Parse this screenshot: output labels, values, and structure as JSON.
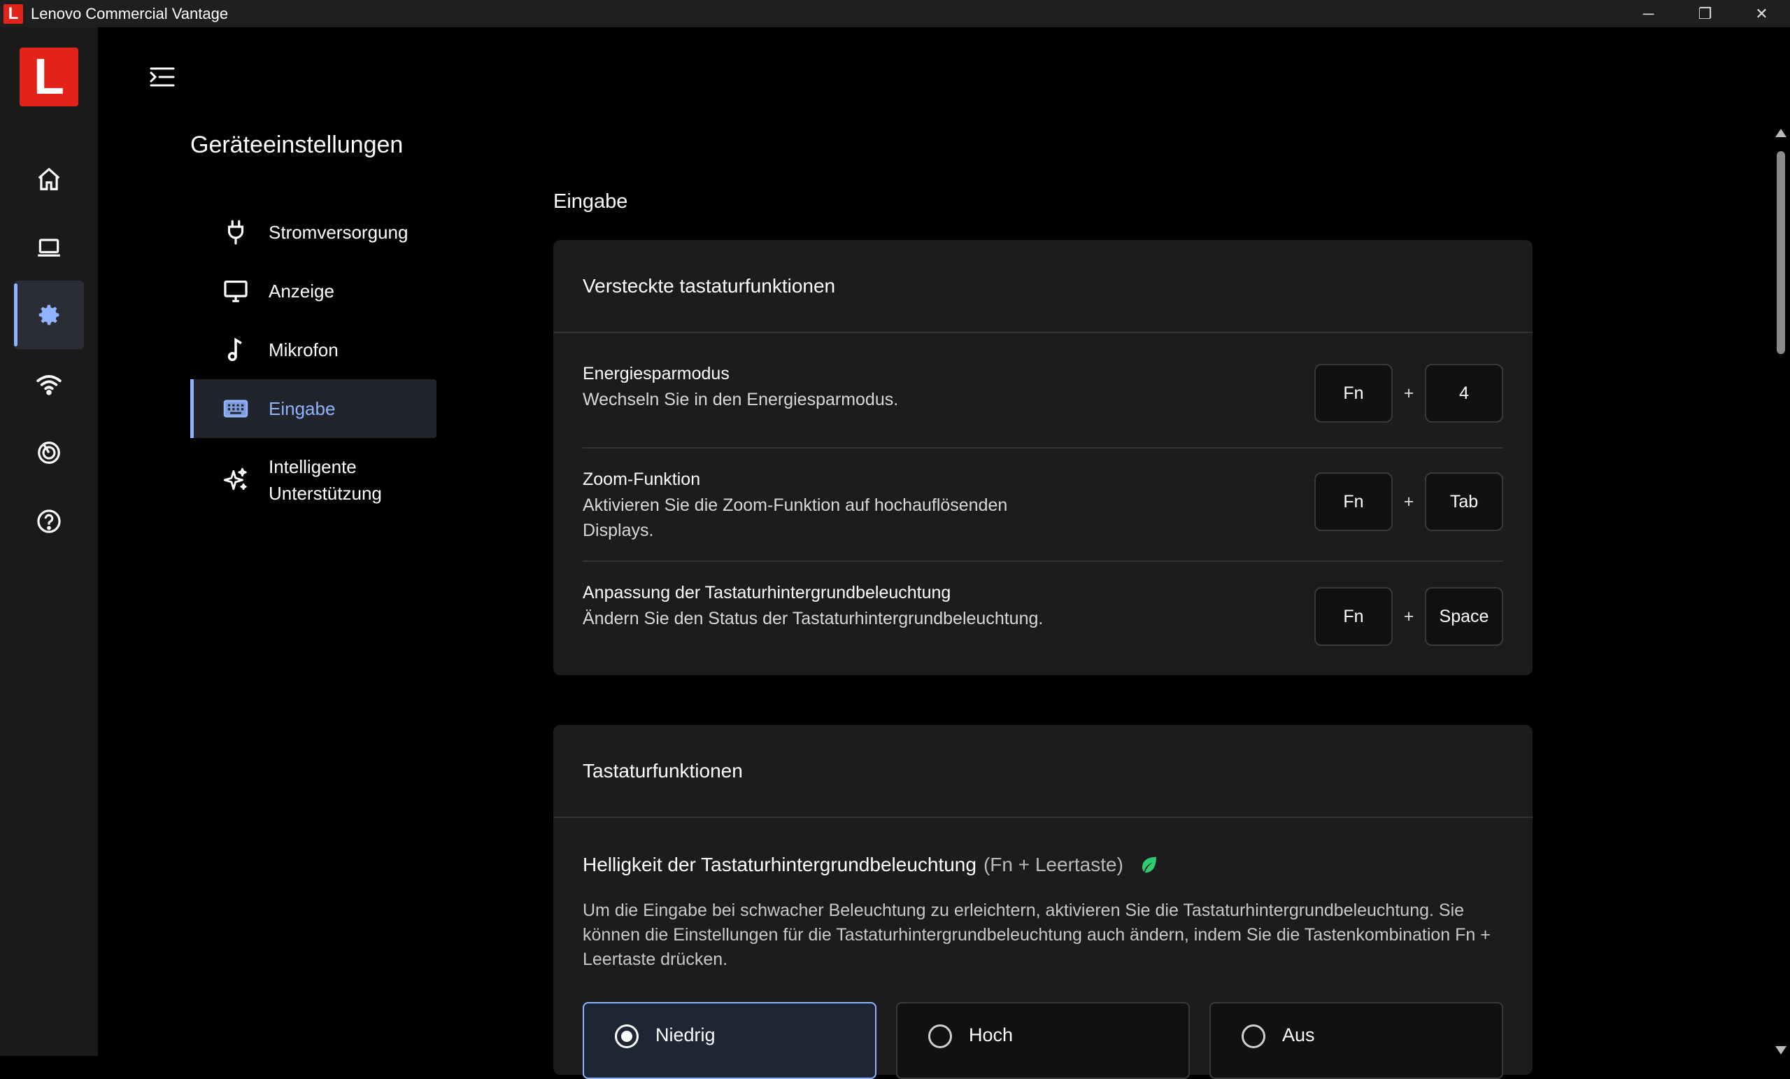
{
  "window": {
    "title": "Lenovo Commercial Vantage",
    "app_logo_letter": "L",
    "controls": {
      "minimize": "─",
      "restore": "❐",
      "close": "✕"
    }
  },
  "rail": {
    "logo_letter": "L",
    "items": [
      {
        "icon": "home-icon"
      },
      {
        "icon": "laptop-icon"
      },
      {
        "icon": "gear-icon",
        "active": true
      },
      {
        "icon": "wifi-icon"
      },
      {
        "icon": "radar-icon"
      },
      {
        "icon": "help-icon"
      }
    ]
  },
  "page": {
    "title": "Geräteeinstellungen"
  },
  "sidenav": {
    "items": [
      {
        "label": "Stromversorgung",
        "icon": "plug-icon"
      },
      {
        "label": "Anzeige",
        "icon": "monitor-icon"
      },
      {
        "label": "Mikrofon",
        "icon": "music-note-icon"
      },
      {
        "label": "Eingabe",
        "icon": "keyboard-icon",
        "active": true
      },
      {
        "label_line1": "Intelligente",
        "label_line2": "Unterstützung",
        "icon": "sparkle-icon"
      }
    ]
  },
  "content": {
    "section_title": "Eingabe",
    "hidden_functions": {
      "title": "Versteckte tastaturfunktionen",
      "rows": [
        {
          "name": "Energiesparmodus",
          "desc": "Wechseln Sie in den Energiesparmodus.",
          "key1": "Fn",
          "plus": "+",
          "key2": "4"
        },
        {
          "name": "Zoom-Funktion",
          "desc": "Aktivieren Sie die Zoom-Funktion auf hochauflösenden Displays.",
          "key1": "Fn",
          "plus": "+",
          "key2": "Tab"
        },
        {
          "name": "Anpassung der Tastaturhintergrundbeleuchtung",
          "desc": "Ändern Sie den Status der Tastaturhintergrundbeleuchtung.",
          "key1": "Fn",
          "plus": "+",
          "key2": "Space"
        }
      ]
    },
    "keyboard_functions": {
      "title": "Tastaturfunktionen",
      "backlight": {
        "heading": "Helligkeit der Tastaturhintergrundbeleuchtung",
        "hint": "(Fn + Leertaste)",
        "desc": "Um die Eingabe bei schwacher Beleuchtung zu erleichtern, aktivieren Sie die Tastaturhintergrundbeleuchtung. Sie können die Einstellungen für die Tastaturhintergrundbeleuchtung auch ändern, indem Sie die Tastenkombination Fn + Leertaste drücken.",
        "options": [
          "Niedrig",
          "Hoch",
          "Aus"
        ],
        "selected": "Niedrig"
      }
    }
  },
  "colors": {
    "accent": "#8fb3ff",
    "brand": "#e2231a",
    "leaf": "#2ecc71"
  }
}
